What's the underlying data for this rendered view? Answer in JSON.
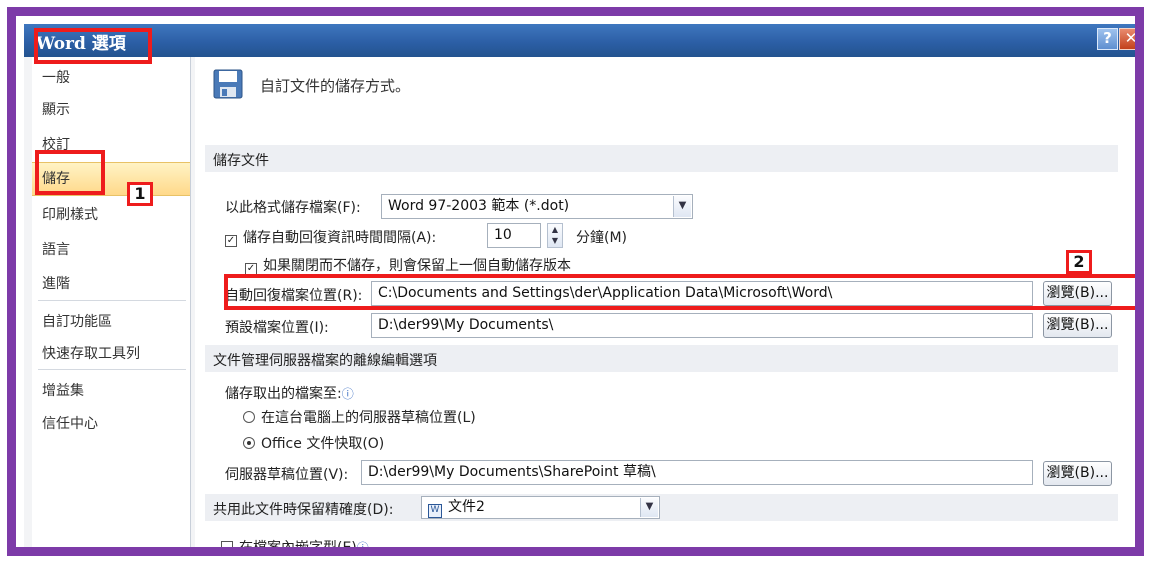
{
  "window": {
    "title": "Word 選項",
    "help": "?",
    "close": "✕"
  },
  "annotations": {
    "badge1": "1",
    "badge2": "2"
  },
  "sidebar": {
    "items": [
      {
        "label": "一般"
      },
      {
        "label": "顯示"
      },
      {
        "label": "校訂"
      },
      {
        "label": "儲存"
      },
      {
        "label": "印刷樣式"
      },
      {
        "label": "語言"
      },
      {
        "label": "進階"
      },
      {
        "label": "自訂功能區"
      },
      {
        "label": "快速存取工具列"
      },
      {
        "label": "增益集"
      },
      {
        "label": "信任中心"
      }
    ]
  },
  "content": {
    "header": "自訂文件的儲存方式。",
    "save_section": {
      "title": "儲存文件",
      "format_label": "以此格式儲存檔案(F):",
      "format_value": "Word 97-2003 範本 (*.dot)",
      "autorecover_label": "儲存自動回復資訊時間間隔(A):",
      "autorecover_value": "10",
      "minutes_label": "分鐘(M)",
      "keep_last_label": "如果關閉而不儲存，則會保留上一個自動儲存版本",
      "autorecover_path_label": "自動回復檔案位置(R):",
      "autorecover_path_value": "C:\\Documents and Settings\\der\\Application Data\\Microsoft\\Word\\",
      "default_path_label": "預設檔案位置(I):",
      "default_path_value": "D:\\der99\\My Documents\\",
      "browse_label": "瀏覽(B)..."
    },
    "offline_section": {
      "title": "文件管理伺服器檔案的離線編輯選項",
      "checkout_label": "儲存取出的檔案至:",
      "option_server": "在這台電腦上的伺服器草稿位置(L)",
      "option_office": "Office 文件快取(O)",
      "drafts_label": "伺服器草稿位置(V):",
      "drafts_value": "D:\\der99\\My Documents\\SharePoint 草稿\\",
      "browse_label": "瀏覽(B)..."
    },
    "fidelity_section": {
      "title": "共用此文件時保留精確度(D):",
      "document_value": "文件2",
      "embed_fonts_label": "在檔案內嵌字型(E)"
    }
  }
}
